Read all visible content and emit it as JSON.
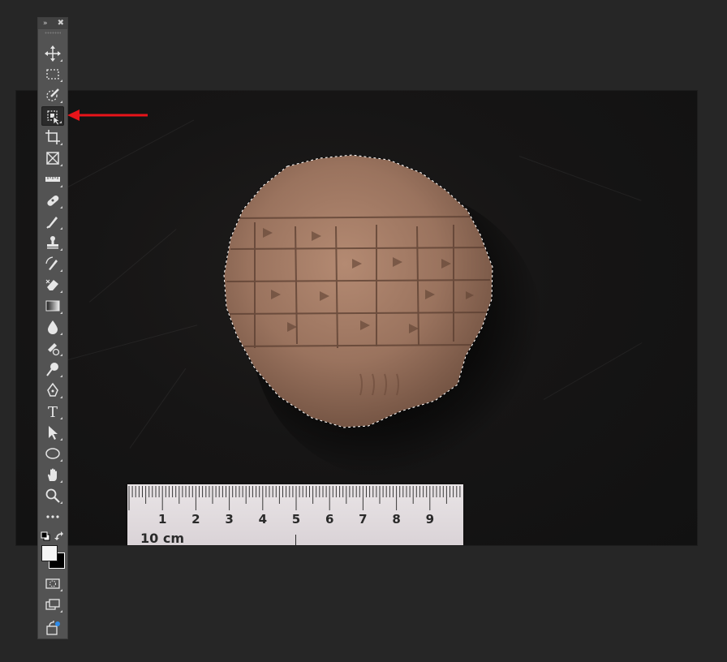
{
  "toolbar": {
    "collapse_label": "»",
    "close_label": "✖",
    "tools": [
      {
        "name": "move-tool",
        "icon": "move-icon"
      },
      {
        "name": "marquee-tool",
        "icon": "rect-marquee-icon"
      },
      {
        "name": "quick-selection-tool",
        "icon": "quick-selection-icon"
      },
      {
        "name": "object-selection-tool",
        "icon": "object-selection-icon",
        "active": true
      },
      {
        "name": "crop-tool",
        "icon": "crop-icon"
      },
      {
        "name": "frame-tool",
        "icon": "frame-icon"
      },
      {
        "name": "ruler-tool",
        "icon": "ruler-icon"
      },
      {
        "name": "healing-brush-tool",
        "icon": "bandage-icon"
      },
      {
        "name": "brush-tool",
        "icon": "brush-icon"
      },
      {
        "name": "stamp-tool",
        "icon": "stamp-icon"
      },
      {
        "name": "history-brush-tool",
        "icon": "history-brush-icon"
      },
      {
        "name": "eraser-tool",
        "icon": "eraser-icon"
      },
      {
        "name": "gradient-tool",
        "icon": "gradient-icon"
      },
      {
        "name": "blur-tool",
        "icon": "drop-icon"
      },
      {
        "name": "sponge-tool",
        "icon": "sponge-icon"
      },
      {
        "name": "dodge-tool",
        "icon": "dodge-icon"
      },
      {
        "name": "pen-tool",
        "icon": "pen-icon"
      },
      {
        "name": "type-tool",
        "icon": "type-icon",
        "glyph": "T"
      },
      {
        "name": "path-selection-tool",
        "icon": "arrow-cursor-icon"
      },
      {
        "name": "ellipse-tool",
        "icon": "ellipse-icon"
      },
      {
        "name": "hand-tool",
        "icon": "hand-icon"
      },
      {
        "name": "zoom-tool",
        "icon": "zoom-icon"
      },
      {
        "name": "edit-toolbar",
        "icon": "more-icon",
        "glyph": "•••"
      }
    ],
    "foreground_color": "#f5f5f5",
    "background_color": "#000000",
    "bottom_tools": [
      {
        "name": "quick-mask-button",
        "icon": "quick-mask-icon"
      },
      {
        "name": "screen-mode-button",
        "icon": "screen-mode-icon"
      },
      {
        "name": "share-image-button",
        "icon": "share-icon"
      }
    ]
  },
  "ruler": {
    "numbers": [
      "1",
      "2",
      "3",
      "4",
      "5",
      "6",
      "7",
      "8",
      "9"
    ],
    "unit_label": "10 cm"
  },
  "colors": {
    "workspace": "#262626",
    "toolbar": "#535353",
    "annotation_arrow": "#e8141a"
  }
}
